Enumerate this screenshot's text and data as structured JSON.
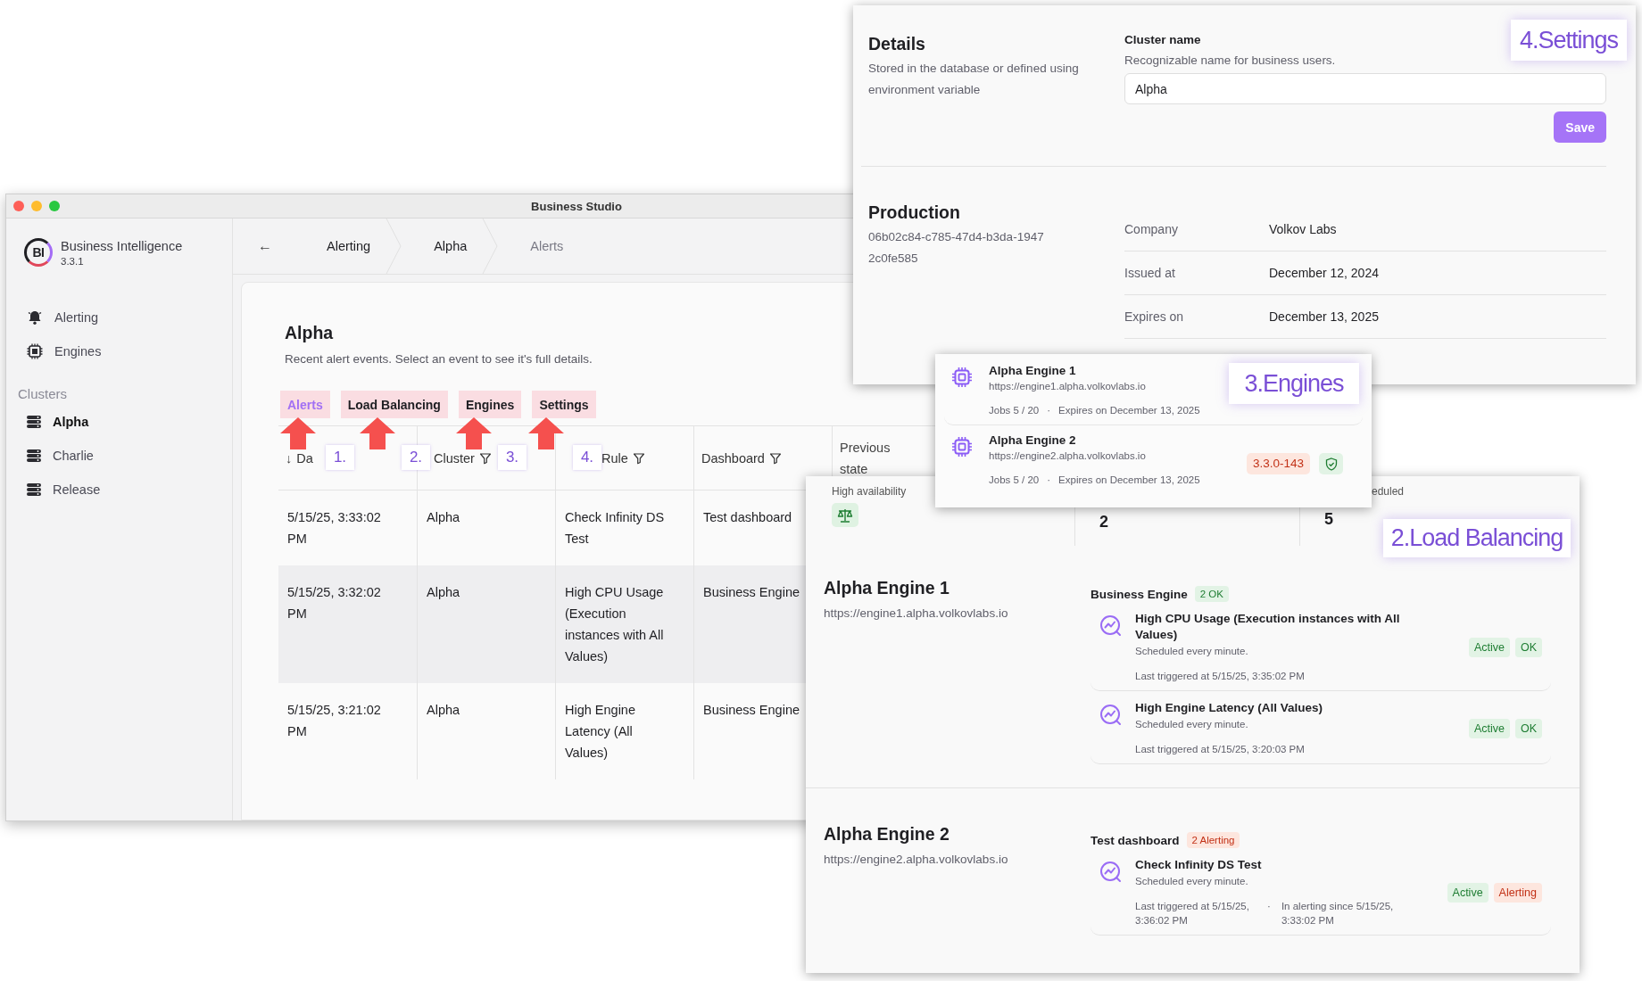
{
  "main_window": {
    "title": "Business Studio",
    "sidebar": {
      "logo": "BI",
      "app_name": "Business Intelligence",
      "version": "3.3.1",
      "nav": [
        {
          "label": "Alerting",
          "selected": false
        },
        {
          "label": "Engines",
          "selected": false
        }
      ],
      "section": "Clusters",
      "clusters": [
        {
          "label": "Alpha",
          "selected": true
        },
        {
          "label": "Charlie",
          "selected": false
        },
        {
          "label": "Release",
          "selected": false
        }
      ]
    },
    "back": "←",
    "breadcrumb": [
      {
        "label": "Alerting",
        "current": false
      },
      {
        "label": "Alpha",
        "current": false
      },
      {
        "label": "Alerts",
        "current": true
      }
    ],
    "page": {
      "title": "Alpha",
      "subtitle": "Recent alert events. Select an event to see it's full details.",
      "tabs": [
        {
          "label": "Alerts",
          "selected": true,
          "marker": "1."
        },
        {
          "label": "Load Balancing",
          "selected": false,
          "marker": "2."
        },
        {
          "label": "Engines",
          "selected": false,
          "marker": "3."
        },
        {
          "label": "Settings",
          "selected": false,
          "marker": "4."
        }
      ],
      "table": {
        "columns": [
          {
            "label": "Da",
            "sort": "↓"
          },
          {
            "label": "Cluster",
            "filter": true
          },
          {
            "label": "Rule",
            "filter": true
          },
          {
            "label": "Dashboard",
            "filter": true
          },
          {
            "label": "Previous state"
          }
        ],
        "rows": [
          {
            "cells": [
              "5/15/25, 3:33:02 PM",
              "Alpha",
              "Check Infinity DS Test",
              "Test dashboard"
            ],
            "highlighted": false
          },
          {
            "cells": [
              "5/15/25, 3:32:02 PM",
              "Alpha",
              "High CPU Usage (Execution instances with All Values)",
              "Business Engine"
            ],
            "highlighted": true
          },
          {
            "cells": [
              "5/15/25, 3:21:02 PM",
              "Alpha",
              "High Engine Latency (All Values)",
              "Business Engine"
            ],
            "highlighted": false
          }
        ]
      }
    }
  },
  "settings_panel": {
    "callout": "4.Settings",
    "details": {
      "title": "Details",
      "description": "Stored in the database or defined using environment variable"
    },
    "cluster_name": {
      "label": "Cluster name",
      "hint": "Recognizable name for business users.",
      "value": "Alpha"
    },
    "save": "Save",
    "production": {
      "title": "Production",
      "id": "06b02c84-c785-47d4-b3da-19472c0fe585",
      "fields": [
        {
          "label": "Company",
          "value": "Volkov Labs"
        },
        {
          "label": "Issued at",
          "value": "December 12, 2024"
        },
        {
          "label": "Expires on",
          "value": "December 13, 2025"
        }
      ]
    }
  },
  "engines_popup": {
    "callout": "3.Engines",
    "engines": [
      {
        "name": "Alpha Engine 1",
        "url": "https://engine1.alpha.volkovlabs.io",
        "jobs": "Jobs 5 / 20",
        "separator": "·",
        "expires": "Expires on December 13, 2025"
      },
      {
        "name": "Alpha Engine 2",
        "url": "https://engine2.alpha.volkovlabs.io",
        "jobs": "Jobs 5 / 20",
        "separator": "·",
        "expires": "Expires on December 13, 2025",
        "version": "3.3.0-143",
        "secured": true
      }
    ]
  },
  "load_balancing_panel": {
    "callout": "2.Load Balancing",
    "stats": [
      {
        "kind": "icon",
        "label": "High availability"
      },
      {
        "kind": "value",
        "value": "2"
      },
      {
        "kind": "value",
        "label": "eduled",
        "value": "5"
      }
    ],
    "engines": [
      {
        "name": "Alpha Engine 1",
        "url": "https://engine1.alpha.volkovlabs.io",
        "dashboard": "Business Engine",
        "summary": {
          "text": "2 OK",
          "kind": "ok"
        },
        "rules": [
          {
            "title": "High CPU Usage (Execution instances with All Values)",
            "schedule": "Scheduled every minute.",
            "last": "Last triggered at 5/15/25, 3:35:02 PM",
            "badges": [
              {
                "text": "Active",
                "kind": "ok"
              },
              {
                "text": "OK",
                "kind": "ok"
              }
            ]
          },
          {
            "title": "High Engine Latency (All Values)",
            "schedule": "Scheduled every minute.",
            "last": "Last triggered at 5/15/25, 3:20:03 PM",
            "badges": [
              {
                "text": "Active",
                "kind": "ok"
              },
              {
                "text": "OK",
                "kind": "ok"
              }
            ]
          }
        ]
      },
      {
        "name": "Alpha Engine 2",
        "url": "https://engine2.alpha.volkovlabs.io",
        "dashboard": "Test dashboard",
        "summary": {
          "text": "2 Alerting",
          "kind": "alert"
        },
        "rules": [
          {
            "title": "Check Infinity DS Test",
            "schedule": "Scheduled every minute.",
            "last": "Last triggered at 5/15/25, 3:36:02 PM",
            "separator": "·",
            "since": "In alerting since 5/15/25, 3:33:02 PM",
            "badges": [
              {
                "text": "Active",
                "kind": "ok"
              },
              {
                "text": "Alerting",
                "kind": "alert"
              }
            ]
          }
        ]
      }
    ]
  }
}
